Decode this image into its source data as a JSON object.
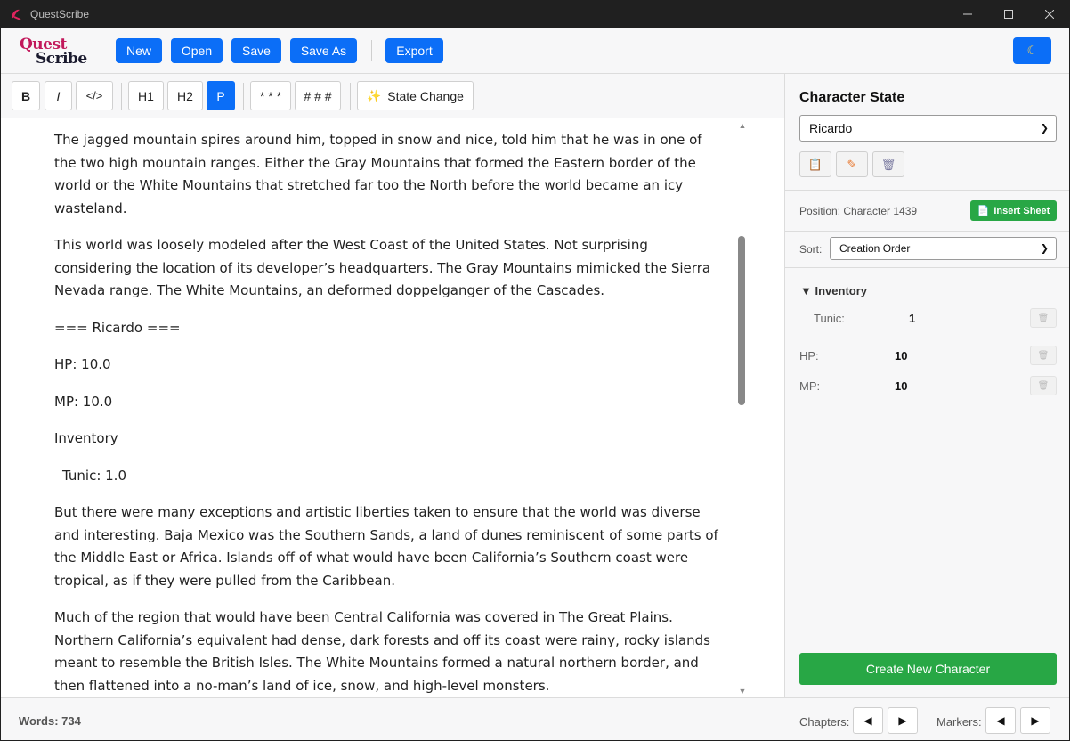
{
  "window": {
    "title": "QuestScribe"
  },
  "logo": {
    "line1": "Quest",
    "line2": "Scribe"
  },
  "toolbar": {
    "new_label": "New",
    "open_label": "Open",
    "save_label": "Save",
    "save_as_label": "Save As",
    "export_label": "Export",
    "theme_icon": "moon-icon"
  },
  "format": {
    "bold": "B",
    "italic": "I",
    "code": "</>",
    "h1": "H1",
    "h2": "H2",
    "p": "P",
    "stars": "* * *",
    "hashes": "# # #",
    "state_change": "State Change",
    "active": "P"
  },
  "editor": {
    "paragraphs": [
      "The jagged mountain spires around him, topped in snow and nice, told him that he was in one of the two high mountain ranges. Either the Gray Mountains that formed the Eastern border of the world or the White Mountains that stretched far too the North before the world became an icy wasteland.",
      "This world was loosely modeled after the West Coast of the United States. Not surprising considering the location of its developer’s headquarters. The Gray Mountains mimicked the Sierra Nevada range. The White Mountains, an deformed doppelganger of the Cascades.",
      "=== Ricardo ===",
      "HP: 10.0",
      "MP: 10.0",
      "Inventory",
      "Tunic: 1.0",
      "But there were many exceptions and artistic liberties taken to ensure that the world was diverse and interesting. Baja Mexico was the Southern Sands, a land of dunes reminiscent of some parts of the Middle East or Africa. Islands off of what would have been California’s Southern coast were tropical, as if they were pulled from the Caribbean.",
      "Much of the region that would have been Central California was covered in The Great Plains. Northern California’s equivalent had dense, dark forests and off its coast were rainy, rocky islands meant to resemble the British Isles. The White Mountains formed a natural northern border, and then flattened into a no-man’s land of ice, snow, and high-level monsters."
    ]
  },
  "status": {
    "words": "Words: 734",
    "chapters_label": "Chapters:",
    "markers_label": "Markers:"
  },
  "panel": {
    "title": "Character State",
    "character": "Ricardo",
    "position": "Position: Character 1439",
    "insert_sheet": "Insert Sheet",
    "sort_label": "Sort:",
    "sort_value": "Creation Order",
    "inventory_header": "Inventory",
    "inventory_items": [
      {
        "name": "Tunic:",
        "value": "1"
      }
    ],
    "stats": [
      {
        "name": "HP:",
        "value": "10"
      },
      {
        "name": "MP:",
        "value": "10"
      }
    ],
    "create_button": "Create New Character"
  },
  "colors": {
    "primary": "#0b6ef7",
    "success": "#28a745",
    "logo_accent": "#c2185b"
  }
}
